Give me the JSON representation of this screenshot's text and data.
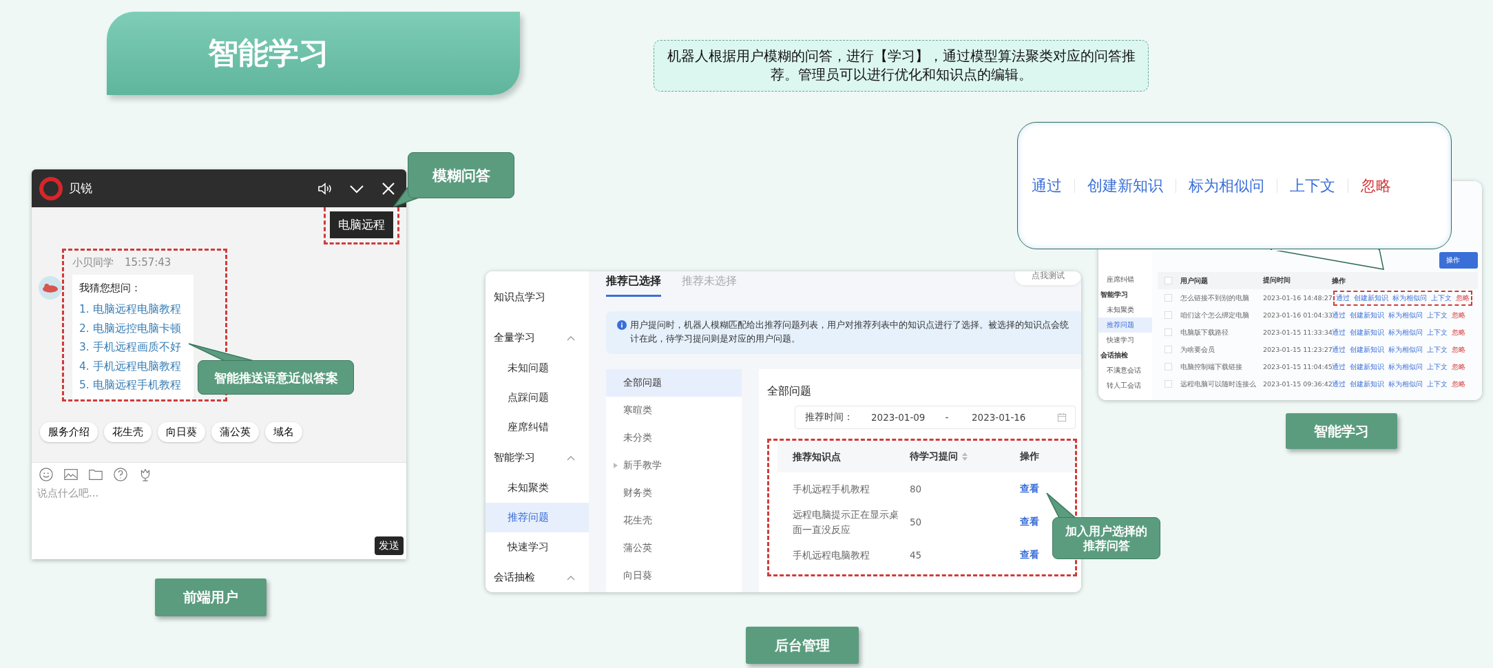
{
  "title": "智能学习",
  "note": "机器人根据用户模糊的问答，进行【学习】，通过模型算法聚类对应的问答推荐。管理员可以进行优化和知识点的编辑。",
  "chat": {
    "window_title": "贝锐",
    "user_message": "电脑远程",
    "bot_name": "小贝同学",
    "time": "15:57:43",
    "prompt": "我猜您想问：",
    "suggestions": [
      "1. 电脑远程电脑教程",
      "2. 电脑远控电脑卡顿",
      "3. 手机远程画质不好",
      "4. 手机远程电脑教程",
      "5. 电脑远程手机教程"
    ],
    "quick_replies": [
      "服务介绍",
      "花生壳",
      "向日葵",
      "蒲公英",
      "域名"
    ],
    "placeholder": "说点什么吧...",
    "send": "发送"
  },
  "chat_callouts": [
    "模糊问答",
    "智能推送语意近似答案"
  ],
  "chat_label": "前端用户",
  "admin": {
    "sidebar": [
      {
        "label": "知识点学习",
        "kind": "title"
      },
      {
        "label": "全量学习",
        "kind": "group",
        "expanded": true,
        "children": [
          {
            "label": "未知问题",
            "selected": false
          },
          {
            "label": "点踩问题",
            "selected": false
          },
          {
            "label": "座席纠错",
            "selected": false
          }
        ]
      },
      {
        "label": "智能学习",
        "kind": "group",
        "expanded": true,
        "children": [
          {
            "label": "未知聚类",
            "selected": false
          },
          {
            "label": "推荐问题",
            "selected": true
          },
          {
            "label": "快速学习",
            "selected": false
          }
        ]
      },
      {
        "label": "会话抽检",
        "kind": "group",
        "expanded": true
      }
    ],
    "tabs": [
      {
        "label": "推荐已选择",
        "selected": true
      },
      {
        "label": "推荐未选择",
        "selected": false
      }
    ],
    "test_button": "点我测试",
    "info": "用户提问时，机器人模糊匹配给出推荐问题列表，用户对推荐列表中的知识点进行了选择。被选择的知识点会统计在此，待学习提问则是对应的用户问题。",
    "categories": [
      {
        "label": "全部问题",
        "selected": true,
        "expandable": false
      },
      {
        "label": "寒暄类",
        "selected": false,
        "expandable": false
      },
      {
        "label": "未分类",
        "selected": false,
        "expandable": false
      },
      {
        "label": "新手教学",
        "selected": false,
        "expandable": true
      },
      {
        "label": "财务类",
        "selected": false,
        "expandable": false
      },
      {
        "label": "花生壳",
        "selected": false,
        "expandable": false
      },
      {
        "label": "蒲公英",
        "selected": false,
        "expandable": false
      },
      {
        "label": "向日葵",
        "selected": false,
        "expandable": false
      }
    ],
    "panel_title": "全部问题",
    "date_label": "推荐时间：",
    "date_start": "2023-01-09",
    "date_sep": "-",
    "date_end": "2023-01-16",
    "columns": [
      "推荐知识点",
      "待学习提问",
      "操作"
    ],
    "rows": [
      {
        "topic": "手机远程手机教程",
        "count": "80",
        "action": "查看"
      },
      {
        "topic": "远程电脑提示正在显示桌面一直没反应",
        "count": "50",
        "action": "查看"
      },
      {
        "topic": "手机远程电脑教程",
        "count": "45",
        "action": "查看"
      }
    ]
  },
  "admin_callout": "加入用户选择的推荐问答",
  "admin_label": "后台管理",
  "review": {
    "sidebar": [
      {
        "label": "座席纠错",
        "kind": "item",
        "selected": false
      },
      {
        "label": "智能学习",
        "kind": "group",
        "selected": false
      },
      {
        "label": "未知聚类",
        "kind": "item",
        "selected": false
      },
      {
        "label": "推荐问题",
        "kind": "item",
        "selected": true
      },
      {
        "label": "快速学习",
        "kind": "item",
        "selected": false
      },
      {
        "label": "会话抽检",
        "kind": "group",
        "selected": false
      },
      {
        "label": "不满意会话",
        "kind": "item",
        "selected": false
      },
      {
        "label": "转人工会话",
        "kind": "item",
        "selected": false
      }
    ],
    "batch_button": "操作",
    "all_checked": false,
    "columns": [
      "用户问题",
      "提问时间",
      "操作"
    ],
    "rows": [
      {
        "checked": false,
        "question": "怎么链接不到别的电脑",
        "time": "2023-01-16 14:48:27",
        "actions": [
          {
            "label": "通过",
            "kind": "link"
          },
          {
            "label": "创建新知识",
            "kind": "link"
          },
          {
            "label": "标为相似问",
            "kind": "link"
          },
          {
            "label": "上下文",
            "kind": "link"
          },
          {
            "label": "忽略",
            "kind": "danger"
          }
        ]
      },
      {
        "checked": false,
        "question": "咱们这个怎么绑定电脑",
        "time": "2023-01-16 01:04:33",
        "actions": [
          {
            "label": "通过",
            "kind": "link"
          },
          {
            "label": "创建新知识",
            "kind": "link"
          },
          {
            "label": "标为相似问",
            "kind": "link"
          },
          {
            "label": "上下文",
            "kind": "link"
          },
          {
            "label": "忽略",
            "kind": "danger"
          }
        ]
      },
      {
        "checked": false,
        "question": "电脑版下载路径",
        "time": "2023-01-15 11:33:34",
        "actions": [
          {
            "label": "通过",
            "kind": "link"
          },
          {
            "label": "创建新知识",
            "kind": "link"
          },
          {
            "label": "标为相似问",
            "kind": "link"
          },
          {
            "label": "上下文",
            "kind": "link"
          },
          {
            "label": "忽略",
            "kind": "danger"
          }
        ]
      },
      {
        "checked": false,
        "question": "为啥要会员",
        "time": "2023-01-15 11:23:27",
        "actions": [
          {
            "label": "通过",
            "kind": "link"
          },
          {
            "label": "创建新知识",
            "kind": "link"
          },
          {
            "label": "标为相似问",
            "kind": "link"
          },
          {
            "label": "上下文",
            "kind": "link"
          },
          {
            "label": "忽略",
            "kind": "danger"
          }
        ]
      },
      {
        "checked": false,
        "question": "电脑控制端下载链接",
        "time": "2023-01-15 11:04:45",
        "actions": [
          {
            "label": "通过",
            "kind": "link"
          },
          {
            "label": "创建新知识",
            "kind": "link"
          },
          {
            "label": "标为相似问",
            "kind": "link"
          },
          {
            "label": "上下文",
            "kind": "link"
          },
          {
            "label": "忽略",
            "kind": "danger"
          }
        ]
      },
      {
        "checked": false,
        "question": "远程电脑可以随时连接么",
        "time": "2023-01-15 09:36:42",
        "actions": [
          {
            "label": "通过",
            "kind": "link"
          },
          {
            "label": "创建新知识",
            "kind": "link"
          },
          {
            "label": "标为相似问",
            "kind": "link"
          },
          {
            "label": "上下文",
            "kind": "link"
          },
          {
            "label": "忽略",
            "kind": "danger"
          }
        ]
      }
    ]
  },
  "review_callout": [
    {
      "label": "通过",
      "kind": "link"
    },
    {
      "label": "创建新知识",
      "kind": "link"
    },
    {
      "label": "标为相似问",
      "kind": "link"
    },
    {
      "label": "上下文",
      "kind": "link"
    },
    {
      "label": "忽略",
      "kind": "danger"
    }
  ],
  "review_label": "智能学习"
}
